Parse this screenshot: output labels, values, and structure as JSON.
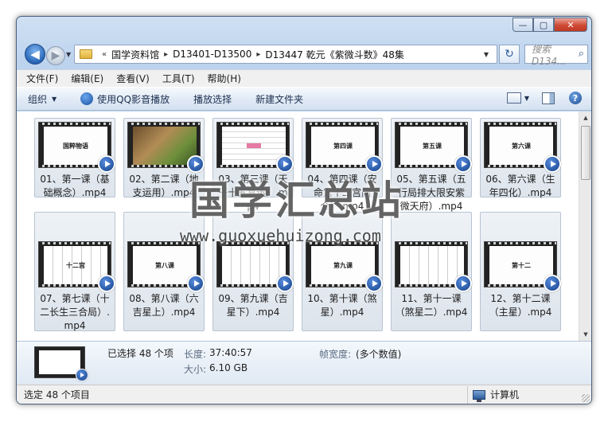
{
  "window": {
    "caption_buttons": {
      "minimize": "—",
      "maximize": "▢",
      "close": "✕"
    }
  },
  "nav": {
    "back": "◀",
    "forward": "▶",
    "history": "▼",
    "overflow": "«",
    "breadcrumbs": [
      "国学资料馆",
      "D13401-D13500",
      "D13447 乾元《紫微斗数》48集"
    ],
    "chevron": "▸",
    "address_dropdown": "▼",
    "refresh": "↻",
    "search_placeholder": "搜索 D134...",
    "search_icon": "⌕"
  },
  "menubar": [
    "文件(F)",
    "编辑(E)",
    "查看(V)",
    "工具(T)",
    "帮助(H)"
  ],
  "toolbar": {
    "organize": "组织",
    "dropdown_glyph": "▼",
    "play_qq": "使用QQ影音播放",
    "play_selection": "播放选择",
    "new_folder": "新建文件夹",
    "help": "?"
  },
  "files": [
    {
      "label": "01、第一课（基础概念）.mp4",
      "slide": "国粹物语",
      "style": "plain"
    },
    {
      "label": "02、第二课（地支运用）.mp4",
      "slide": "",
      "style": "photo"
    },
    {
      "label": "03、第三课（天干十五宫运）.mp4",
      "slide": "",
      "style": "grid"
    },
    {
      "label": "04、第四课（安命宫十二宫简介）.mp4",
      "slide": "第四课",
      "style": "plain"
    },
    {
      "label": "05、第五课（五行局排大限安紫微天府）.mp4",
      "slide": "第五课",
      "style": "plain"
    },
    {
      "label": "06、第六课（生年四化）.mp4",
      "slide": "第六课",
      "style": "plain"
    },
    {
      "label": "07、第七课（十二长生三合局）.mp4",
      "slide": "十二宫",
      "style": "chart"
    },
    {
      "label": "08、第八课（六吉星上）.mp4",
      "slide": "第八课",
      "style": "plain"
    },
    {
      "label": "09、第九课（吉星下）.mp4",
      "slide": "",
      "style": "chart"
    },
    {
      "label": "10、第十课（煞星）.mp4",
      "slide": "第九课",
      "style": "plain"
    },
    {
      "label": "11、第十一课（煞星二）.mp4",
      "slide": "",
      "style": "chart"
    },
    {
      "label": "12、第十二课（主星）.mp4",
      "slide": "第十二",
      "style": "plain"
    }
  ],
  "scrollbar": {
    "up": "▲",
    "down": "▼"
  },
  "details": {
    "selected": "已选择 48 个项",
    "length_label": "长度:",
    "length_value": "37:40:57",
    "size_label": "大小:",
    "size_value": "6.10 GB",
    "frame_width_label": "帧宽度:",
    "frame_width_value": "(多个数值)"
  },
  "status": {
    "left": "选定 48 个项目",
    "right": "计算机"
  },
  "watermark": {
    "title": "国学汇总站",
    "url": "www.guoxuehuizong.com"
  }
}
